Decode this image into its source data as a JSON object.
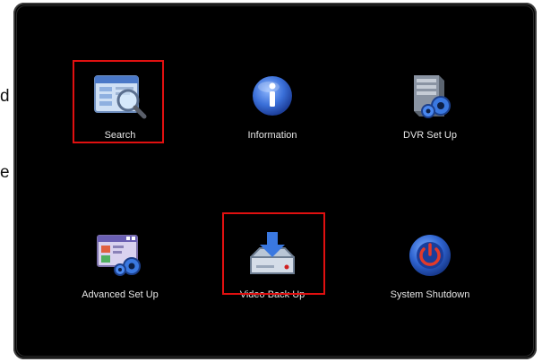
{
  "side_text": {
    "char1": "d",
    "char2": "e"
  },
  "menu": {
    "items": [
      {
        "label": "Search",
        "icon": "search-icon",
        "highlighted": true
      },
      {
        "label": "Information",
        "icon": "info-icon",
        "highlighted": false
      },
      {
        "label": "DVR Set Up",
        "icon": "dvr-setup-icon",
        "highlighted": false
      },
      {
        "label": "Advanced Set Up",
        "icon": "advanced-setup-icon",
        "highlighted": false
      },
      {
        "label": "Video Back Up",
        "icon": "video-backup-icon",
        "highlighted": true
      },
      {
        "label": "System Shutdown",
        "icon": "power-icon",
        "highlighted": false
      }
    ]
  },
  "colors": {
    "background": "#000000",
    "highlight": "#e01010",
    "accent_blue": "#3a6fd8"
  }
}
